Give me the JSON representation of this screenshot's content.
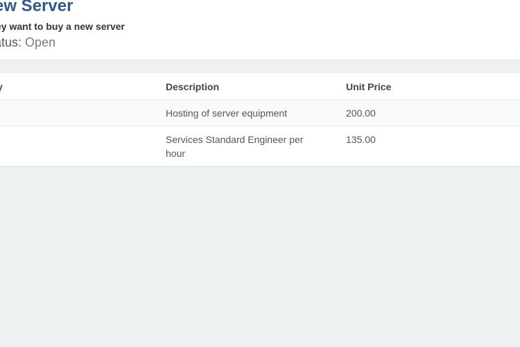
{
  "header": {
    "title": "ew Server",
    "subtitle": "ey want to buy a new server",
    "status_label": "atus:",
    "status_value": "Open"
  },
  "table": {
    "columns": [
      "y",
      "Description",
      "Unit Price"
    ],
    "rows": [
      {
        "first": "",
        "description": "Hosting of server equipment",
        "unit_price": "200.00"
      },
      {
        "first": "",
        "description": "Services Standard Engineer per hour",
        "unit_price": "135.00"
      }
    ]
  }
}
